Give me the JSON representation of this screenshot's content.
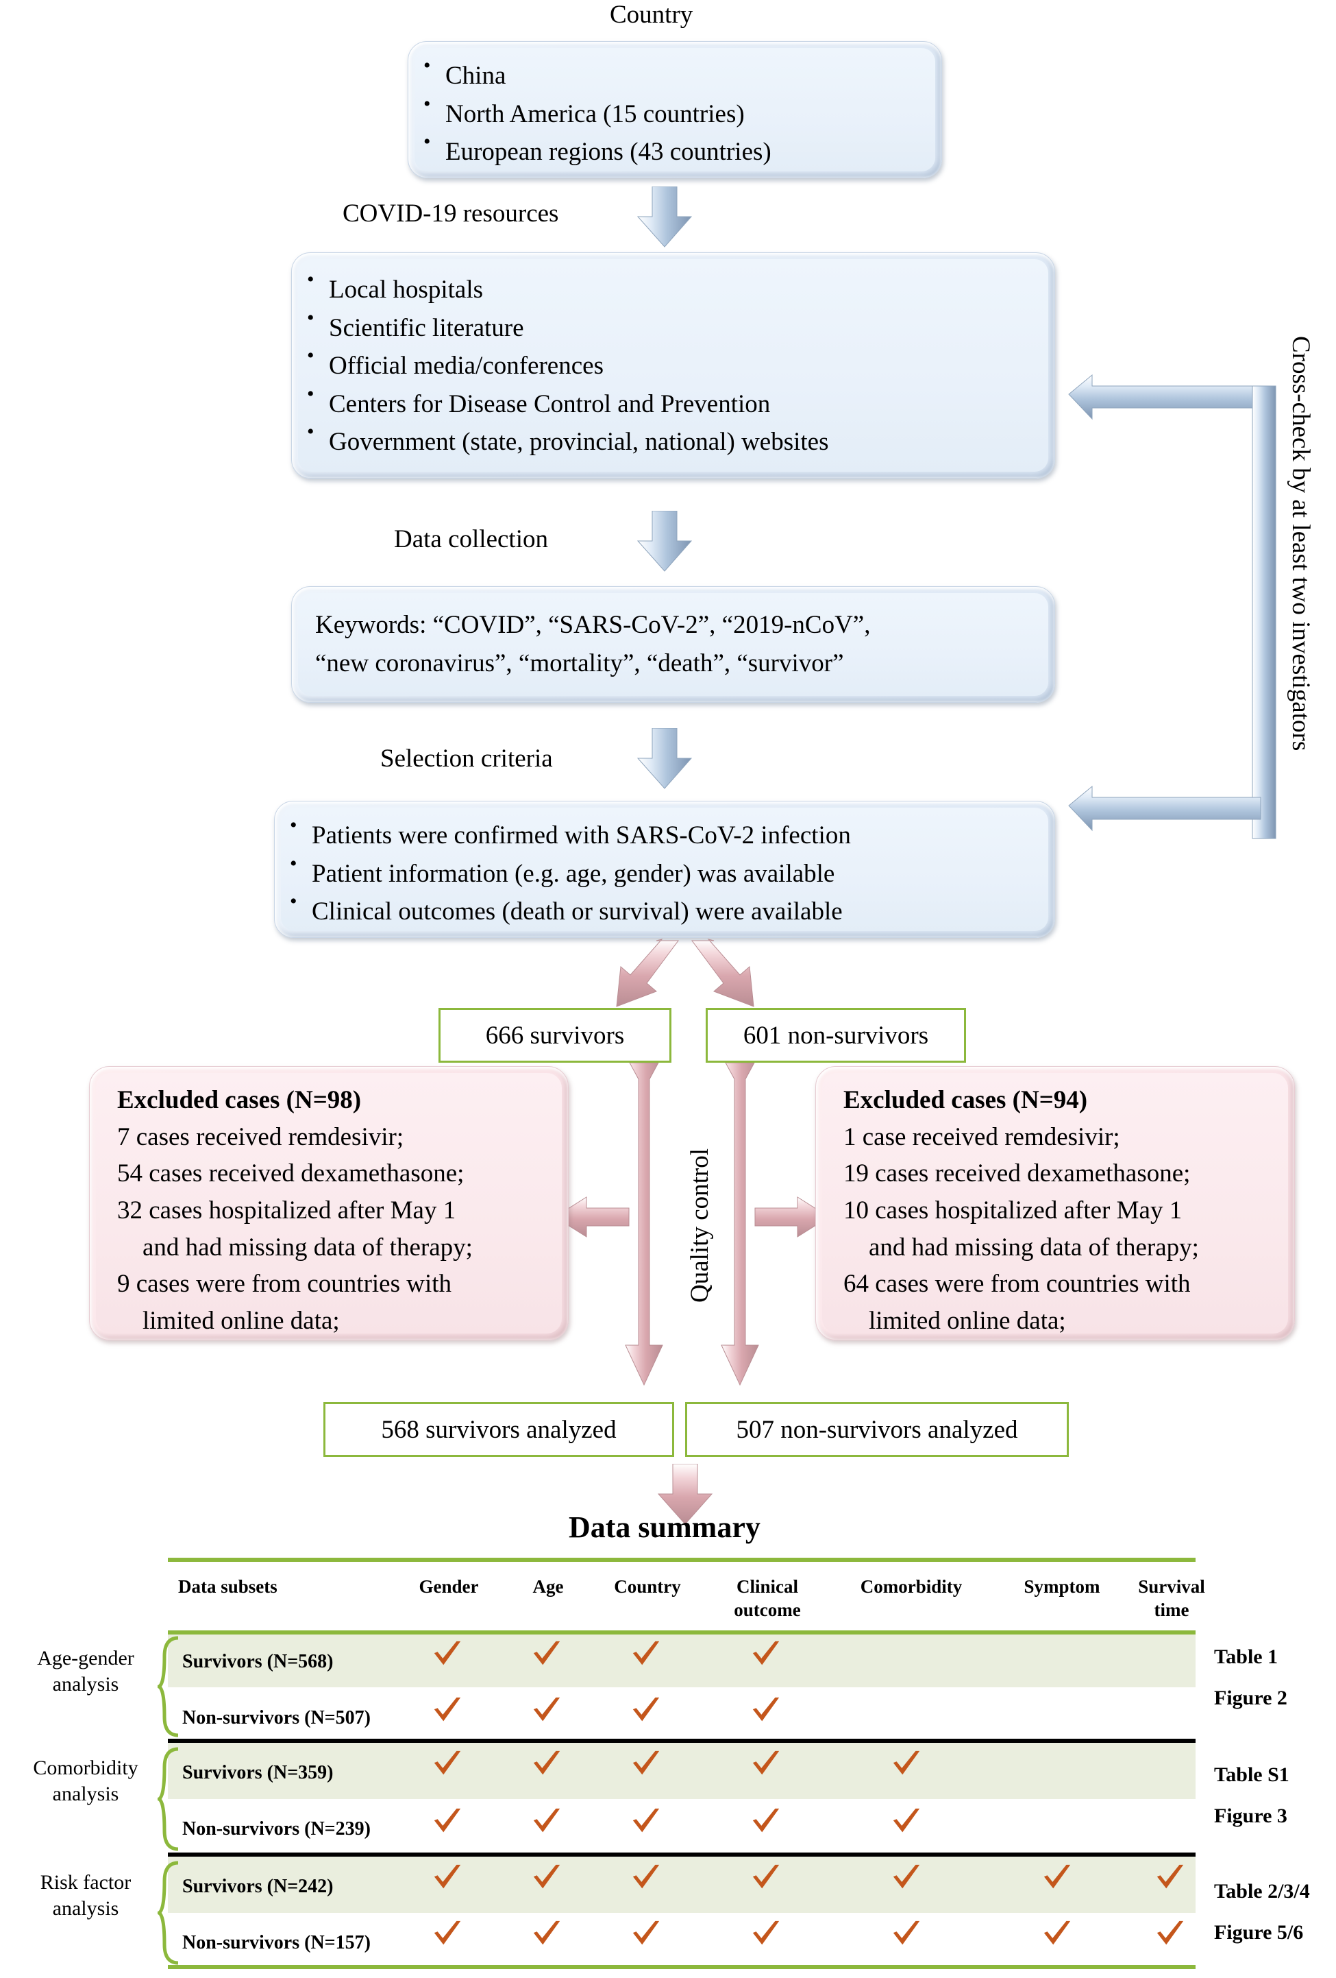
{
  "colors": {
    "green_rule": "#8cb83c",
    "row_shade": "#eaeede",
    "check": "#c4561b",
    "blue_box": "#e6eef8",
    "pink_box": "#fae9ec"
  },
  "flow": {
    "country_label": "Country",
    "country_box": {
      "items": [
        "China",
        "North America (15 countries)",
        "European regions (43 countries)"
      ]
    },
    "arrow1_label": "COVID-19 resources",
    "resources_box": {
      "items": [
        "Local hospitals",
        "Scientific literature",
        "Official media/conferences",
        "Centers for Disease Control and Prevention",
        "Government (state, provincial, national) websites"
      ]
    },
    "arrow2_label": "Data collection",
    "keywords_box": {
      "line1": "Keywords: “COVID”, “SARS-CoV-2”, “2019-nCoV”,",
      "line2": "“new coronavirus”, “mortality”, “death”, “survivor”"
    },
    "arrow3_label": "Selection criteria",
    "criteria_box": {
      "items": [
        "Patients were confirmed with SARS-CoV-2 infection",
        "Patient information (e.g. age, gender) was available",
        "Clinical outcomes (death or survival) were available"
      ]
    },
    "crosscheck_label": "Cross-check by at least two investigators",
    "quality_control_label": "Quality control",
    "survivors_box": "666 survivors",
    "nonsurvivors_box": "601 non-survivors",
    "survivors_analyzed_box": "568 survivors analyzed",
    "nonsurvivors_analyzed_box": "507 non-survivors analyzed",
    "excluded_left": {
      "title": "Excluded cases (N=98)",
      "lines": [
        "7 cases received remdesivir;",
        "54 cases received dexamethasone;",
        "32 cases hospitalized after May 1",
        "    and had missing data of therapy;",
        "9 cases were from countries with",
        "    limited online data;"
      ]
    },
    "excluded_right": {
      "title": "Excluded cases (N=94)",
      "lines": [
        "1 case received remdesivir;",
        "19 cases received dexamethasone;",
        "10 cases hospitalized after May 1",
        "    and had missing data of therapy;",
        "64 cases were from countries with",
        "    limited online data;"
      ]
    }
  },
  "summary": {
    "title": "Data summary",
    "first_col_header": "Data subsets",
    "columns": [
      "Gender",
      "Age",
      "Country",
      "Clinical\noutcome",
      "Comorbidity",
      "Symptom",
      "Survival\ntime"
    ],
    "column_labels": {
      "c0": "Gender",
      "c1": "Age",
      "c2": "Country",
      "c3_line1": "Clinical",
      "c3_line2": "outcome",
      "c4": "Comorbidity",
      "c5": "Symptom",
      "c6_line1": "Survival",
      "c6_line2": "time"
    },
    "groups": [
      {
        "label_line1": "Age-gender",
        "label_line2": "analysis",
        "reference_line1": "Table 1",
        "reference_line2": "Figure 2",
        "rows": [
          {
            "label": "Survivors (N=568)",
            "checks": [
              true,
              true,
              true,
              true,
              false,
              false,
              false
            ]
          },
          {
            "label": "Non-survivors (N=507)",
            "checks": [
              true,
              true,
              true,
              true,
              false,
              false,
              false
            ]
          }
        ]
      },
      {
        "label_line1": "Comorbidity",
        "label_line2": "analysis",
        "reference_line1": "Table S1",
        "reference_line2": "Figure 3",
        "rows": [
          {
            "label": "Survivors (N=359)",
            "checks": [
              true,
              true,
              true,
              true,
              true,
              false,
              false
            ]
          },
          {
            "label": "Non-survivors (N=239)",
            "checks": [
              true,
              true,
              true,
              true,
              true,
              false,
              false
            ]
          }
        ]
      },
      {
        "label_line1": "Risk factor",
        "label_line2": "analysis",
        "reference_line1": "Table 2/3/4",
        "reference_line2": "Figure 5/6",
        "rows": [
          {
            "label": "Survivors (N=242)",
            "checks": [
              true,
              true,
              true,
              true,
              true,
              true,
              true
            ]
          },
          {
            "label": "Non-survivors (N=157)",
            "checks": [
              true,
              true,
              true,
              true,
              true,
              true,
              true
            ]
          }
        ]
      }
    ]
  }
}
